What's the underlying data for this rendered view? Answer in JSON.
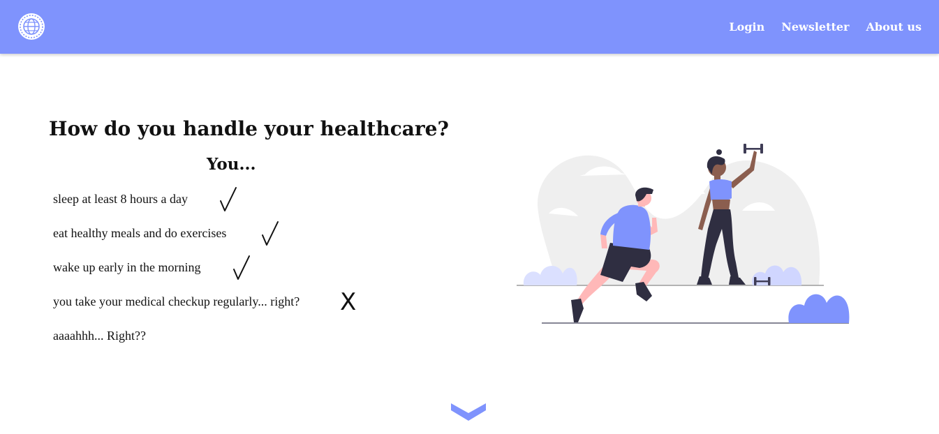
{
  "nav": {
    "logo_icon": "globe-icon",
    "links": [
      "Login",
      "Newsletter",
      "About us"
    ]
  },
  "hero": {
    "title": "How do you handle your healthcare?",
    "subtitle": "You...",
    "habits": [
      {
        "text": "sleep at least 8 hours a day",
        "mark": "check-icon"
      },
      {
        "text": "eat healthy meals and do exercises",
        "mark": "check-icon"
      },
      {
        "text": "wake up early in the morning",
        "mark": "check-icon"
      },
      {
        "text": "you take your medical checkup regularly... right?",
        "mark": "X"
      },
      {
        "text": "aaaahhh... Right??",
        "mark": ""
      }
    ],
    "illustration": "fitness-people-illustration"
  },
  "scroll": {
    "icon": "chevron-down-icon"
  },
  "colors": {
    "accent": "#7f93fd",
    "text": "#111111",
    "background": "#ffffff"
  }
}
